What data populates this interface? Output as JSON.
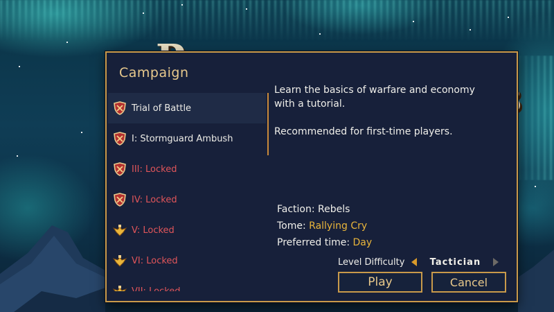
{
  "background": {
    "title_text": "D‌‌ ‌ ‌‌ ‌ ‌",
    "title_tail": "3"
  },
  "dialog": {
    "title": "Campaign",
    "missions": [
      {
        "label": "Trial of Battle",
        "locked": false,
        "emblem": "shield-crest-icon",
        "selected": true
      },
      {
        "label": "I: Stormguard Ambush",
        "locked": false,
        "emblem": "shield-crest-icon",
        "selected": false
      },
      {
        "label": "III:  Locked",
        "locked": true,
        "emblem": "shield-crest-icon",
        "selected": false
      },
      {
        "label": "IV:  Locked",
        "locked": true,
        "emblem": "shield-crest-icon",
        "selected": false
      },
      {
        "label": "V:  Locked",
        "locked": true,
        "emblem": "winged-crest-icon",
        "selected": false
      },
      {
        "label": "VI:  Locked",
        "locked": true,
        "emblem": "winged-crest-icon",
        "selected": false
      },
      {
        "label": "VII:  Locked",
        "locked": true,
        "emblem": "winged-crest-icon",
        "selected": false
      }
    ],
    "description": [
      "Learn the basics of warfare and economy with a tutorial.",
      "Recommended for first-time players."
    ],
    "faction_label": "Faction: Rebels",
    "tome_label": "Tome: ",
    "tome_value": "Rallying Cry",
    "time_label": "Preferred time: ",
    "time_value": "Day",
    "difficulty_label": "Level Difficulty",
    "difficulty_value": "Tactician",
    "play_label": "Play",
    "cancel_label": "Cancel"
  },
  "colors": {
    "accent": "#c99a4a",
    "panel": "#17203a",
    "locked": "#e0555a",
    "highlight": "#e9b53a"
  }
}
